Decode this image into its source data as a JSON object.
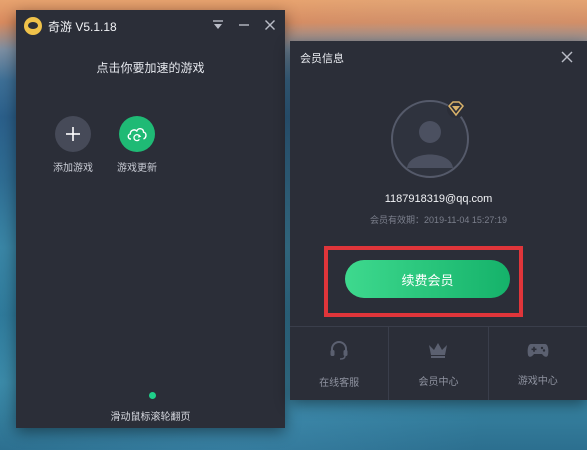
{
  "app": {
    "title": "奇游 V5.1.18",
    "subtitle": "点击你要加速的游戏",
    "tiles": [
      {
        "label": "添加游戏",
        "icon": "plus-icon"
      },
      {
        "label": "游戏更新",
        "icon": "cloud-refresh-icon"
      }
    ],
    "scroll_hint": "滑动鼠标滚轮翻页"
  },
  "member_panel": {
    "title": "会员信息",
    "email": "1187918319@qq.com",
    "expiry": "会员有效期：2019-11-04 15:27:19",
    "renew_label": "续费会员",
    "nav": [
      {
        "label": "在线客服",
        "icon": "headset-icon"
      },
      {
        "label": "会员中心",
        "icon": "crown-icon"
      },
      {
        "label": "游戏中心",
        "icon": "gamepad-icon"
      }
    ]
  },
  "colors": {
    "panel_bg": "#2b2e38",
    "accent_green": "#1fba75",
    "highlight_red": "#e0353a"
  }
}
